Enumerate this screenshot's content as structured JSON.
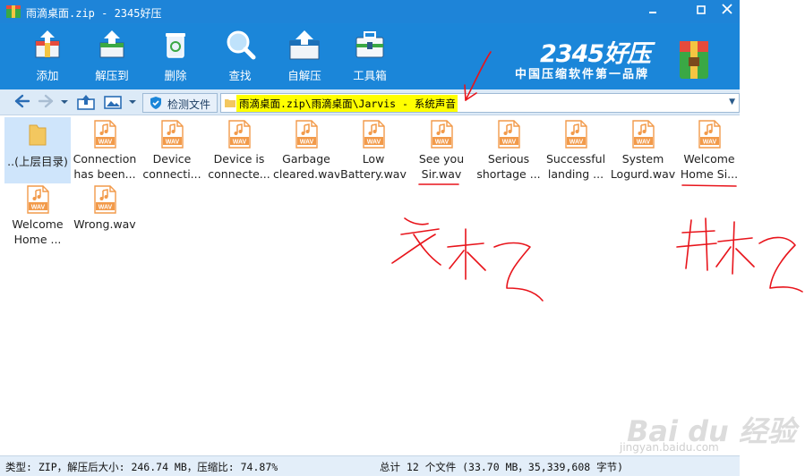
{
  "window": {
    "title": "雨滴桌面.zip - 2345好压",
    "controls": [
      "minimize",
      "maximize",
      "close"
    ]
  },
  "toolbar": {
    "items": [
      {
        "label": "添加",
        "icon": "add-archive-icon"
      },
      {
        "label": "解压到",
        "icon": "extract-to-icon"
      },
      {
        "label": "删除",
        "icon": "delete-bin-icon"
      },
      {
        "label": "查找",
        "icon": "search-magnifier-icon"
      },
      {
        "label": "自解压",
        "icon": "self-extract-icon"
      },
      {
        "label": "工具箱",
        "icon": "toolbox-icon"
      }
    ],
    "brand_name": "2345好压",
    "brand_slogan": "中国压缩软件第一品牌"
  },
  "addressbar": {
    "check_button": "检测文件",
    "path": "雨滴桌面.zip\\雨滴桌面\\Jarvis - 系统声音",
    "highlight_color": "#ffff00"
  },
  "files": [
    {
      "line1": "..(上层目录)",
      "line2": "",
      "type": "folder"
    },
    {
      "line1": "Connection",
      "line2": "has been...",
      "type": "wav"
    },
    {
      "line1": "Device",
      "line2": "connecti...",
      "type": "wav"
    },
    {
      "line1": "Device is",
      "line2": "connecte...",
      "type": "wav"
    },
    {
      "line1": "Garbage",
      "line2": "cleared.wav",
      "type": "wav"
    },
    {
      "line1": "Low",
      "line2": "Battery.wav",
      "type": "wav"
    },
    {
      "line1": "See you",
      "line2": "Sir.wav",
      "type": "wav"
    },
    {
      "line1": "Serious",
      "line2": "shortage ...",
      "type": "wav"
    },
    {
      "line1": "Successful",
      "line2": "landing ...",
      "type": "wav"
    },
    {
      "line1": "System",
      "line2": "Logurd.wav",
      "type": "wav"
    },
    {
      "line1": "Welcome",
      "line2": "Home Si...",
      "type": "wav"
    },
    {
      "line1": "Welcome",
      "line2": "Home ...",
      "type": "wav"
    },
    {
      "line1": "Wrong.wav",
      "line2": "",
      "type": "wav"
    }
  ],
  "status": {
    "left": "类型: ZIP，解压后大小: 246.74 MB，压缩比: 74.87%",
    "right": "总计 12 个文件 (33.70 MB，35,339,608 字节)"
  },
  "watermark": {
    "text": "Bai du 经验",
    "sub": "jingyan.baidu.com"
  },
  "colors": {
    "titlebar": "#1e84d8",
    "toolbar": "#1b86d9",
    "annotation_red": "#e8141b",
    "wav_icon": "#f29a4a"
  }
}
